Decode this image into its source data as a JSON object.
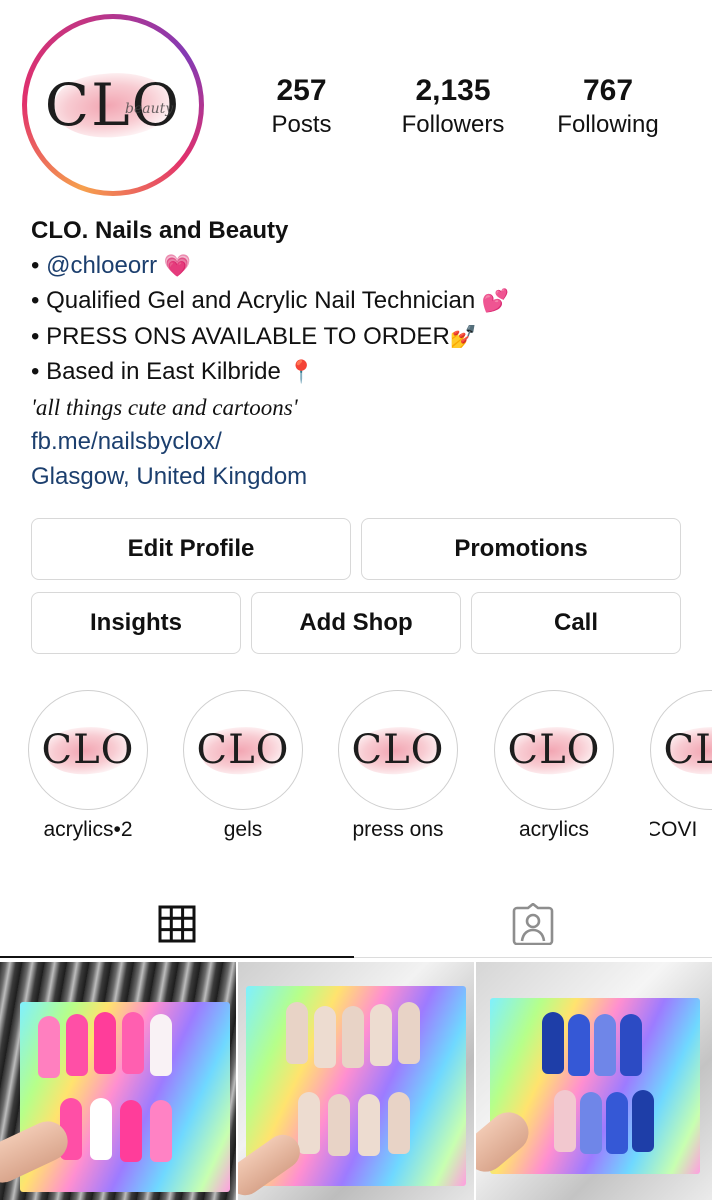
{
  "profile": {
    "logo_text": "CLO",
    "logo_script": "beauty",
    "stats": [
      {
        "value": "257",
        "label": "Posts"
      },
      {
        "value": "2,135",
        "label": "Followers"
      },
      {
        "value": "767",
        "label": "Following"
      }
    ],
    "bio": {
      "name": "CLO. Nails and Beauty",
      "handle_prefix": "•",
      "handle": "@chloeorr",
      "handle_emoji": "💗",
      "line2": "• Qualified Gel and Acrylic Nail Technician",
      "line2_emoji": "💕",
      "line3": "• PRESS ONS AVAILABLE TO ORDER",
      "line3_emoji": "💅",
      "line4": "• Based in East Kilbride",
      "line4_emoji": "📍",
      "quote": "'all things cute and cartoons'",
      "website": "fb.me/nailsbyclox/",
      "location": "Glasgow, United Kingdom"
    }
  },
  "buttons": {
    "edit_profile": "Edit Profile",
    "promotions": "Promotions",
    "insights": "Insights",
    "add_shop": "Add Shop",
    "call": "Call"
  },
  "highlights": [
    {
      "label": "acrylics•2"
    },
    {
      "label": "gels"
    },
    {
      "label": "press ons"
    },
    {
      "label": "acrylics"
    },
    {
      "label": "COVI"
    }
  ],
  "tabs": [
    {
      "icon": "grid-icon",
      "active": true
    },
    {
      "icon": "tagged-person-icon",
      "active": false
    }
  ],
  "colors": {
    "link": "#1c3f6e",
    "ring_gradient": [
      "#f6a04d",
      "#e1306c",
      "#833ab4"
    ],
    "button_border": "#d8d8d8"
  }
}
